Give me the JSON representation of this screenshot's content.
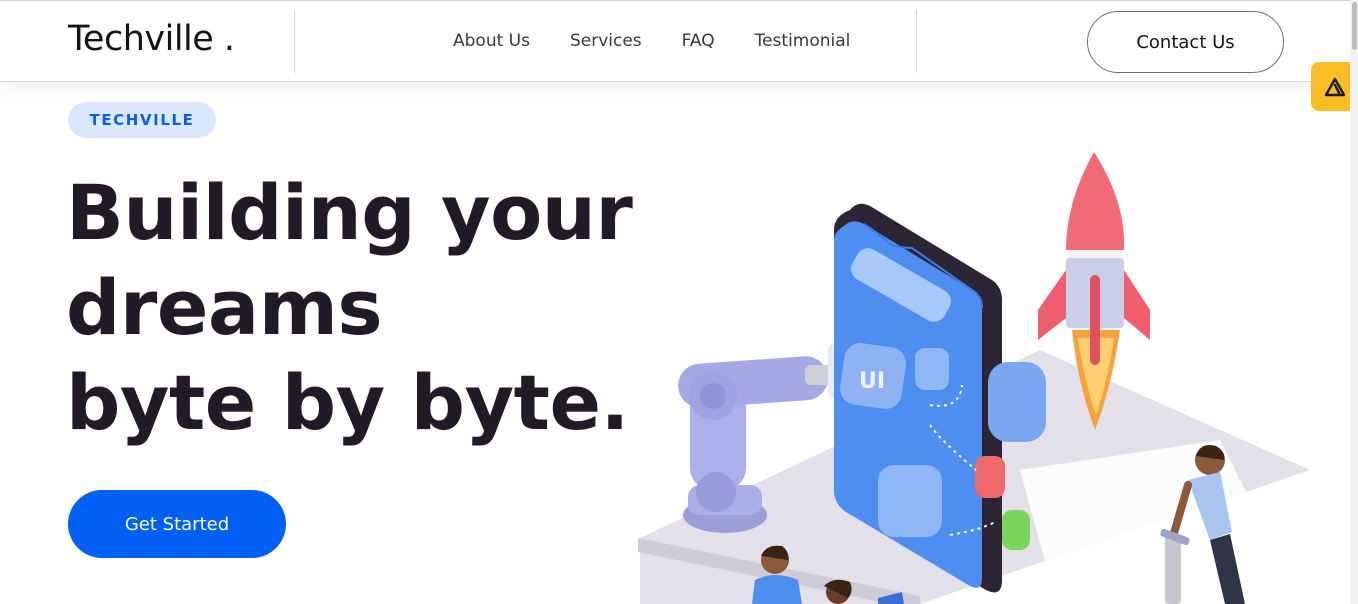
{
  "header": {
    "brand": "Techville .",
    "nav": [
      "About Us",
      "Services",
      "FAQ",
      "Testimonial"
    ],
    "contact_label": "Contact Us"
  },
  "hero": {
    "tag": "TECHVILLE",
    "headline_lines": [
      "Building your",
      "dreams",
      "byte by byte."
    ],
    "cta_label": "Get Started",
    "illustration_label": "UI"
  },
  "widget": {
    "icon": "triangle-logo-icon"
  },
  "colors": {
    "primary": "#0060f6",
    "tag_bg": "#d9e8fd",
    "widget": "#fbbd23",
    "heading": "#221b27"
  }
}
